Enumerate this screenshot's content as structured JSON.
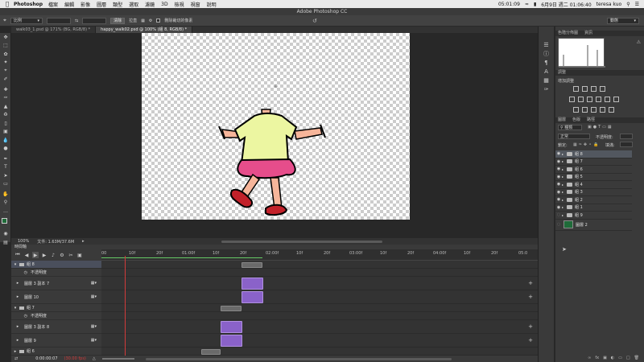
{
  "menubar": {
    "app": "Photoshop",
    "items": [
      "檔案",
      "編輯",
      "影像",
      "圖層",
      "類型",
      "選取",
      "濾鏡",
      "3D",
      "檢視",
      "視窗",
      "說明"
    ],
    "clock": "05:01:09",
    "datetime": "6月9日 週二 01:06:40",
    "user": "teresa kuo",
    "app_title": "Adobe Photoshop CC"
  },
  "optbar": {
    "ratio": "比例",
    "clear": "清除",
    "straighten": "拉直",
    "delete_cropped": "刪除裁切的像素",
    "workspace": "動態"
  },
  "tabs": [
    {
      "label": "walk03_1.psd @ 171% (BG, RGB/8) *",
      "active": false
    },
    {
      "label": "happy_walk02.psd @ 100% (組 8, RGB/8) *",
      "active": true
    }
  ],
  "status": {
    "zoom": "100%",
    "doc": "文件: 1.63M/37.6M"
  },
  "timeline": {
    "title": "時間軸",
    "ticks": [
      "00",
      "10f",
      "20f",
      "01:00f",
      "10f",
      "20f",
      "02:00f",
      "10f",
      "20f",
      "03:00f",
      "10f",
      "20f",
      "04:00f",
      "10f",
      "20f",
      "05:0"
    ],
    "layers": [
      {
        "label": "組 8",
        "type": "group"
      },
      {
        "label": "不透明度",
        "type": "prop"
      },
      {
        "label": "圖層 3 副本 7",
        "type": "layer"
      },
      {
        "label": "圖層 10",
        "type": "layer"
      },
      {
        "label": "組 7",
        "type": "group"
      },
      {
        "label": "不透明度",
        "type": "prop"
      },
      {
        "label": "圖層 3 副本 8",
        "type": "layer"
      },
      {
        "label": "圖層 9",
        "type": "layer"
      },
      {
        "label": "組 6",
        "type": "group"
      }
    ],
    "timecode": "0:00:00:07",
    "fps": "(30.00 fps)"
  },
  "panels": {
    "histogram_tabs": [
      "色階分佈圖",
      "資訊"
    ],
    "adjust_tabs": [
      "調整"
    ],
    "adjust_label": "增加調整",
    "layers_tabs": [
      "圖層",
      "色版",
      "路徑"
    ],
    "kind": "種類",
    "blend": "正常",
    "opacity_label": "不透明度:",
    "lock_label": "鎖定:",
    "fill_label": "填滿:",
    "layers": [
      "組 8",
      "組 7",
      "組 6",
      "組 5",
      "組 4",
      "組 3",
      "組 2",
      "組 1",
      "組 9",
      "圖層 2"
    ]
  }
}
